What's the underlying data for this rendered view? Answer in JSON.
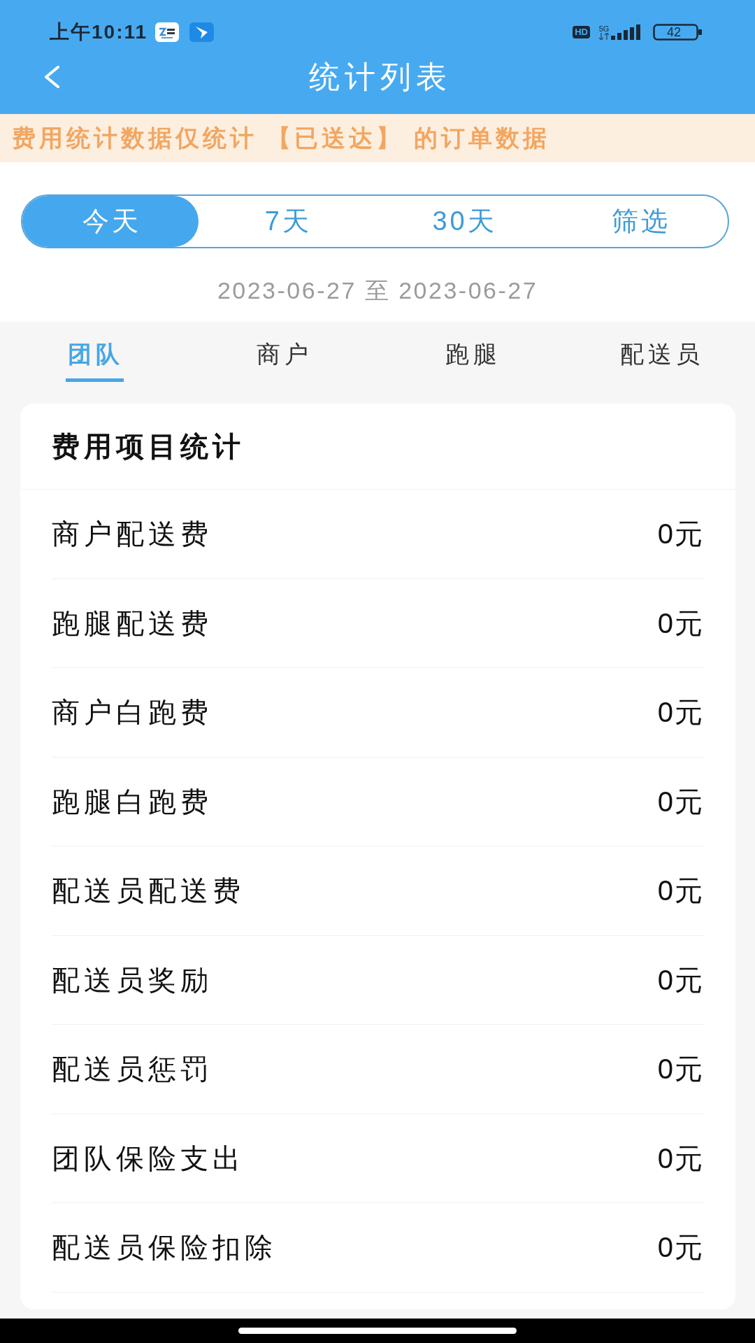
{
  "status_bar": {
    "time": "上午10:11",
    "hd": "HD",
    "network": "5G",
    "battery": "42"
  },
  "header": {
    "title": "统计列表"
  },
  "notice": "费用统计数据仅统计 【已送达】 的订单数据",
  "range_tabs": [
    {
      "label": "今天",
      "selected": true
    },
    {
      "label": "7天",
      "selected": false
    },
    {
      "label": "30天",
      "selected": false
    },
    {
      "label": "筛选",
      "selected": false
    }
  ],
  "date_range": "2023-06-27 至 2023-06-27",
  "category_tabs": [
    {
      "label": "团队",
      "selected": true
    },
    {
      "label": "商户",
      "selected": false
    },
    {
      "label": "跑腿",
      "selected": false
    },
    {
      "label": "配送员",
      "selected": false
    }
  ],
  "fee_card": {
    "title": "费用项目统计",
    "rows": [
      {
        "label": "商户配送费",
        "value": "0元"
      },
      {
        "label": "跑腿配送费",
        "value": "0元"
      },
      {
        "label": "商户白跑费",
        "value": "0元"
      },
      {
        "label": "跑腿白跑费",
        "value": "0元"
      },
      {
        "label": "配送员配送费",
        "value": "0元"
      },
      {
        "label": "配送员奖励",
        "value": "0元"
      },
      {
        "label": "配送员惩罚",
        "value": "0元"
      },
      {
        "label": "团队保险支出",
        "value": "0元"
      },
      {
        "label": "配送员保险扣除",
        "value": "0元"
      }
    ]
  }
}
